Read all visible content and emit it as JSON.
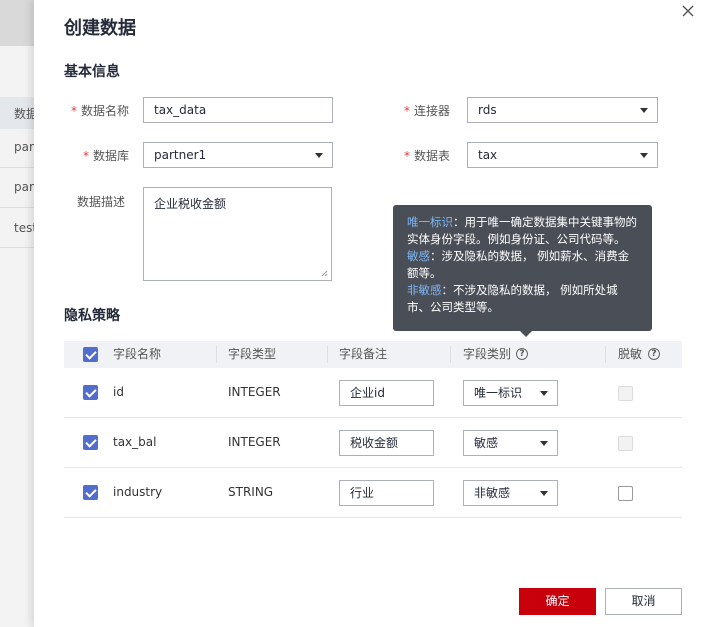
{
  "background": {
    "header_text": "数据",
    "rows": [
      "part",
      "part",
      "test"
    ]
  },
  "dialog": {
    "title": "创建数据"
  },
  "basic_info": {
    "section_title": "基本信息",
    "data_name_label": "数据名称",
    "data_name_value": "tax_data",
    "connector_label": "连接器",
    "connector_value": "rds",
    "database_label": "数据库",
    "database_value": "partner1",
    "table_label": "数据表",
    "table_value": "tax",
    "description_label": "数据描述",
    "description_value": "企业税收金额"
  },
  "privacy": {
    "section_title": "隐私策略",
    "columns": {
      "field_name": "字段名称",
      "field_type": "字段类型",
      "field_comment": "字段备注",
      "field_category": "字段类别",
      "desensitize": "脱敏"
    },
    "rows": [
      {
        "name": "id",
        "type": "INTEGER",
        "comment": "企业id",
        "category": "唯一标识",
        "checked": true,
        "desensitize": "disabled"
      },
      {
        "name": "tax_bal",
        "type": "INTEGER",
        "comment": "税收金额",
        "category": "敏感",
        "checked": true,
        "desensitize": "disabled"
      },
      {
        "name": "industry",
        "type": "STRING",
        "comment": "行业",
        "category": "非敏感",
        "checked": true,
        "desensitize": "unchecked"
      }
    ]
  },
  "tooltip": {
    "unique_term": "唯一标识",
    "unique_desc_1": "：用于唯一确定数据集中关键事物的",
    "unique_desc_2": "实体身份字段。例如身份证、公司代码等。",
    "sensitive_term": "敏感",
    "sensitive_desc_1": "：涉及隐私的数据， 例如薪水、消费金",
    "sensitive_desc_2": "额等。",
    "nonsensitive_term": "非敏感",
    "nonsensitive_desc_1": "：不涉及隐私的数据， 例如所处城",
    "nonsensitive_desc_2": "市、公司类型等。"
  },
  "footer": {
    "confirm_label": "确定",
    "cancel_label": "取消"
  },
  "colors": {
    "primary_red": "#c7000b",
    "checkbox_blue": "#526ecc",
    "tooltip_bg": "#4a4e57",
    "tooltip_highlight": "#7db5f5",
    "required_star": "#e4393c"
  }
}
